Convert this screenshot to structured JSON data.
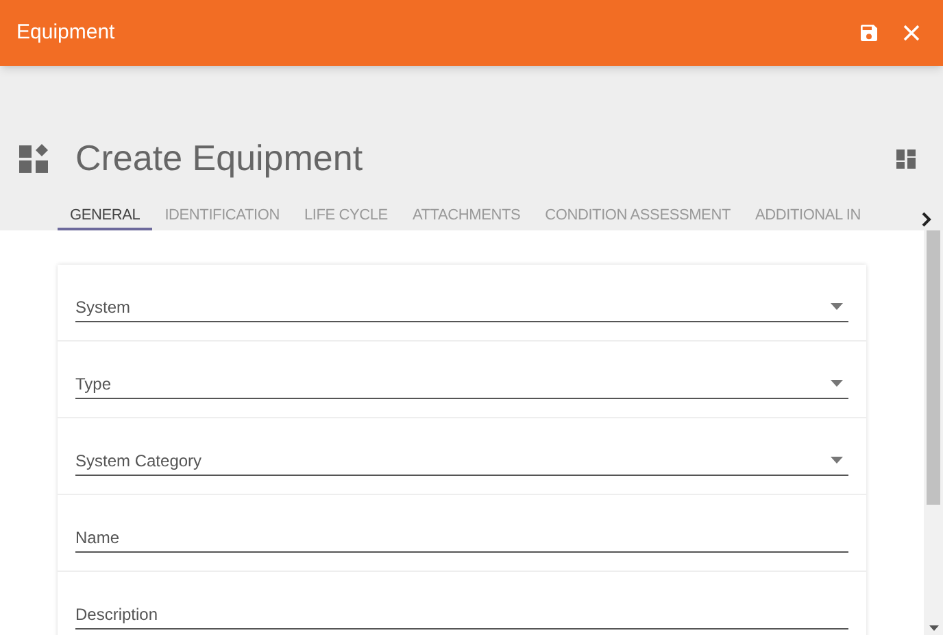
{
  "window": {
    "title": "Equipment"
  },
  "page": {
    "title": "Create Equipment"
  },
  "tabs": [
    {
      "label": "GENERAL",
      "selected": true
    },
    {
      "label": "IDENTIFICATION",
      "selected": false
    },
    {
      "label": "LIFE CYCLE",
      "selected": false
    },
    {
      "label": "ATTACHMENTS",
      "selected": false
    },
    {
      "label": "CONDITION ASSESSMENT",
      "selected": false
    },
    {
      "label": "ADDITIONAL IN",
      "selected": false
    }
  ],
  "fields": [
    {
      "kind": "select",
      "placeholder": "System"
    },
    {
      "kind": "select",
      "placeholder": "Type"
    },
    {
      "kind": "select",
      "placeholder": "System Category"
    },
    {
      "kind": "text",
      "placeholder": "Name"
    },
    {
      "kind": "text",
      "placeholder": "Description"
    }
  ]
}
